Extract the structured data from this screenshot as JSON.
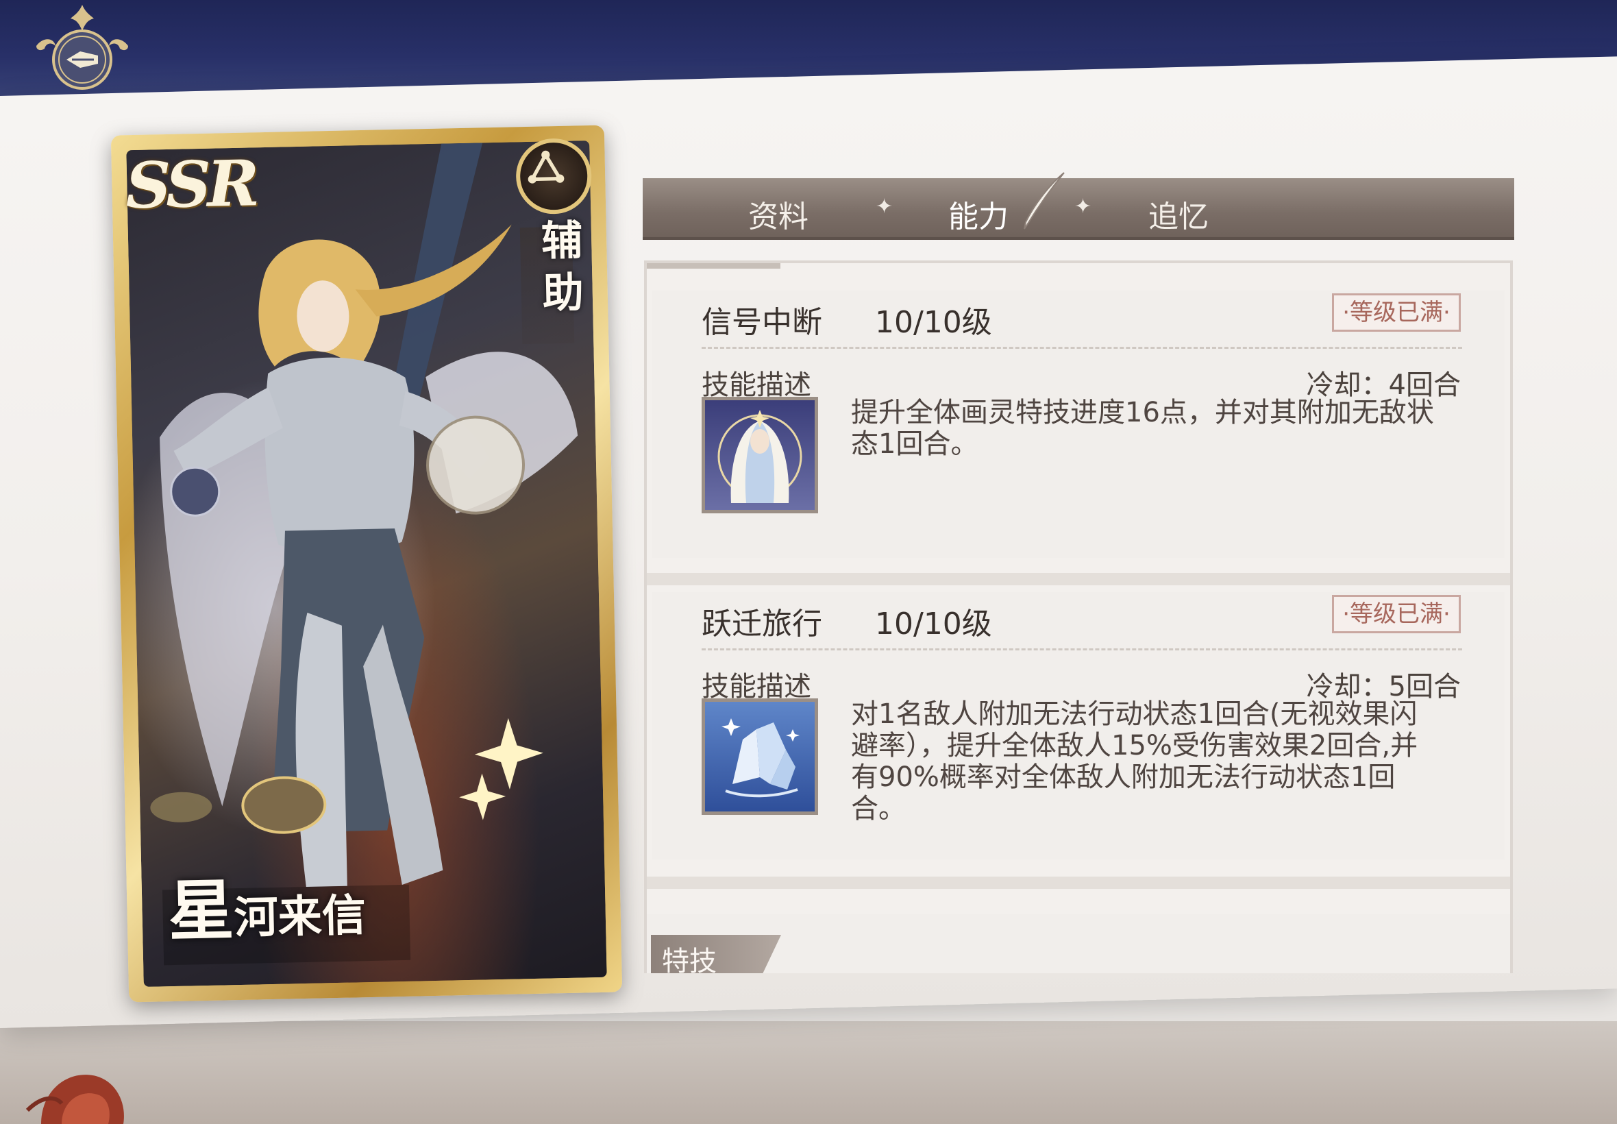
{
  "card": {
    "rarity": "SSR",
    "role": "辅助",
    "name_first": "星",
    "name_rest": "河来信"
  },
  "tabs": [
    {
      "label": "资料",
      "active": false
    },
    {
      "label": "能力",
      "active": true
    },
    {
      "label": "追忆",
      "active": false
    }
  ],
  "tab_separator": "✦",
  "skills": [
    {
      "name": "信号中断",
      "level": "10/10级",
      "badge": "·等级已满·",
      "desc_label": "技能描述",
      "cooldown": "冷却：4回合",
      "description_lines": [
        "提升全体画灵特技进度16点，并对其附加无敌状",
        "态1回合。"
      ],
      "icon": "veiled-maiden-icon"
    },
    {
      "name": "跃迁旅行",
      "level": "10/10级",
      "badge": "·等级已满·",
      "desc_label": "技能描述",
      "cooldown": "冷却：5回合",
      "description_lines": [
        "对1名敌人附加无法行动状态1回合(无视效果闪",
        "避率），提升全体敌人15%受伤害效果2回合,并",
        "有90%概率对全体敌人附加无法行动状态1回",
        "合。"
      ],
      "icon": "crystal-cluster-icon"
    }
  ],
  "special_section": {
    "label": "特技"
  },
  "colors": {
    "navy": "#283068",
    "gold": "#e3c67c",
    "badge_text": "#a7675c",
    "tab_bg": "#7a6d66"
  }
}
